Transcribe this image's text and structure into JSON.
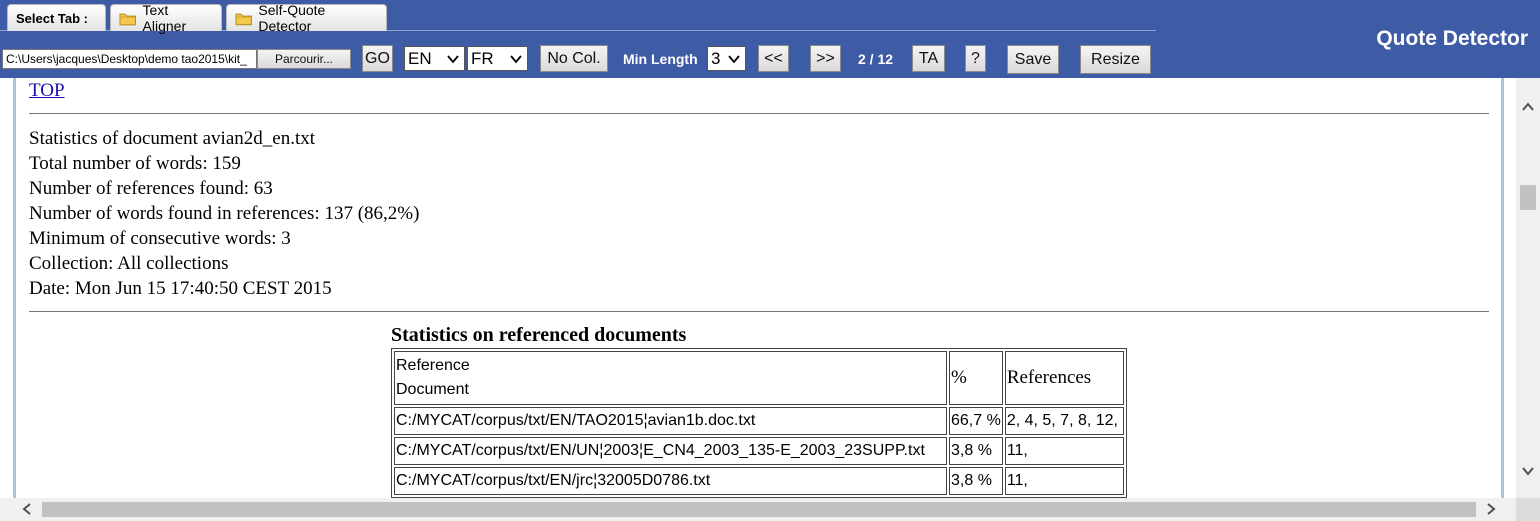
{
  "header": {
    "tabs": [
      {
        "label": "Select Tab :"
      },
      {
        "label": "Text Aligner"
      },
      {
        "label": "Self-Quote Detector"
      }
    ],
    "app_title": "Quote Detector"
  },
  "toolbar": {
    "path_value": "C:\\Users\\jacques\\Desktop\\demo tao2015\\kit_",
    "browse_label": "Parcourir...",
    "go_label": "GO",
    "lang_source": "EN",
    "lang_target": "FR",
    "nocol_label": "No Col.",
    "minlength_label": "Min Length",
    "minlength_value": "3",
    "prev_label": "<<",
    "next_label": ">>",
    "page_indicator": "2 / 12",
    "ta_label": "TA",
    "help_label": "?",
    "save_label": "Save",
    "resize_label": "Resize"
  },
  "content": {
    "top_link": "TOP",
    "stats": [
      "Statistics of document avian2d_en.txt",
      "Total number of words: 159",
      "Number of references found: 63",
      "Number of words found in references: 137 (86,2%)",
      "Minimum of consecutive words: 3",
      "Collection: All collections",
      "Date: Mon Jun 15 17:40:50 CEST 2015"
    ],
    "ref_table": {
      "title": "Statistics on referenced documents",
      "headers": [
        "Reference\nDocument",
        "%",
        "References"
      ],
      "header_line1": "Reference",
      "header_line2": "Document",
      "rows": [
        [
          "C:/MYCAT/corpus/txt/EN/TAO2015¦avian1b.doc.txt",
          "66,7 %",
          "2, 4, 5, 7, 8, 12,"
        ],
        [
          "C:/MYCAT/corpus/txt/EN/UN¦2003¦E_CN4_2003_135-E_2003_23SUPP.txt",
          "3,8 %",
          "11,"
        ],
        [
          "C:/MYCAT/corpus/txt/EN/jrc¦32005D0786.txt",
          "3,8 %",
          "11,"
        ]
      ]
    }
  },
  "colors": {
    "header_blue": "#3e5ba6",
    "frame_blue": "#a6c5e4",
    "link": "#1a0dab"
  }
}
